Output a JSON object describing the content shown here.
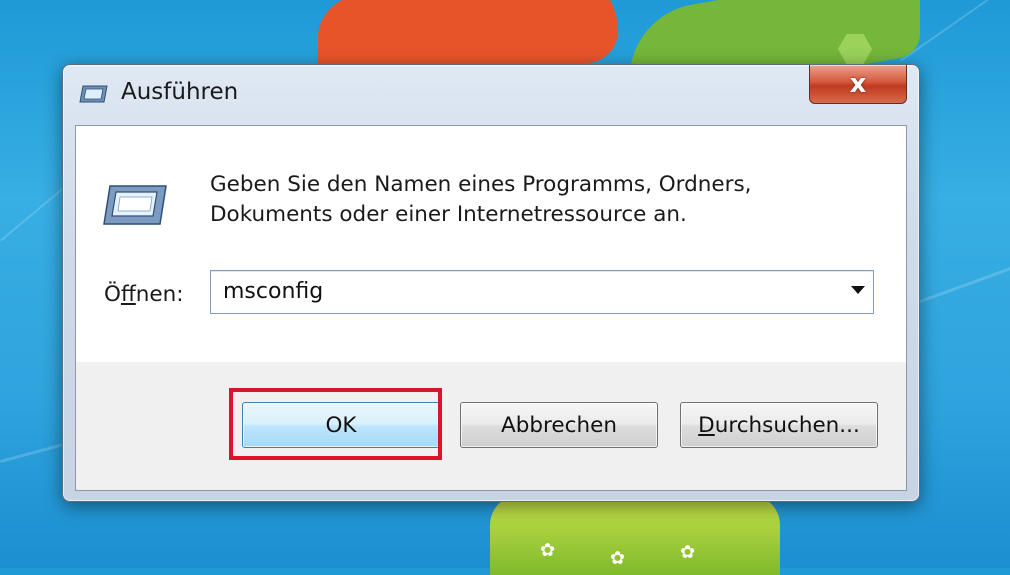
{
  "dialog": {
    "title": "Ausführen",
    "description_line1": "Geben Sie den Namen eines Programms, Ordners,",
    "description_line2": "Dokuments oder einer Internetressource an.",
    "open_label_prefix": "Ö",
    "open_label_mnemonic": "f",
    "open_label_suffix": "fnen:",
    "open_value": "msconfig",
    "close_glyph": "x"
  },
  "buttons": {
    "ok": "OK",
    "cancel": "Abbrechen",
    "browse_mnemonic": "D",
    "browse_rest": "urchsuchen..."
  },
  "colors": {
    "highlight": "#d9142b",
    "close_button": "#c03a1f",
    "desktop_blue": "#2fa3dd"
  },
  "icons": {
    "title_icon": "run-icon",
    "dialog_icon": "run-icon",
    "close_icon": "close-icon",
    "dropdown_icon": "chevron-down-icon"
  }
}
